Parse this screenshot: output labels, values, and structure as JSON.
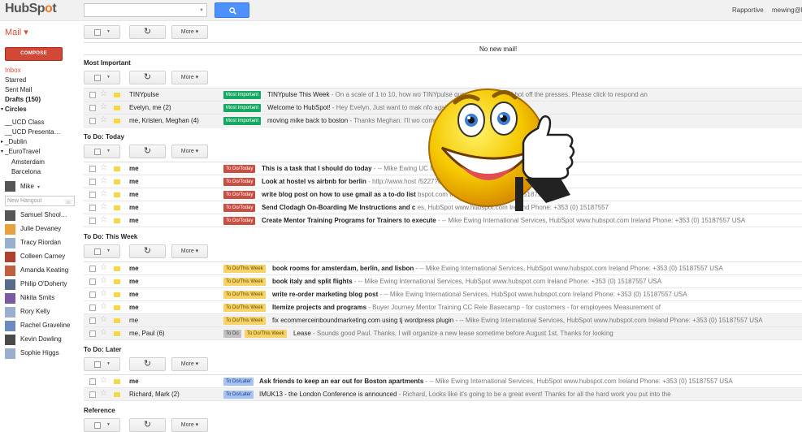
{
  "header": {
    "search_placeholder": "",
    "user_name": "Rapportive",
    "user_email": "mewing@l"
  },
  "sidebar": {
    "mail_label": "Mail ▾",
    "compose_label": "COMPOSE",
    "items": [
      {
        "label": "Inbox",
        "style": "red"
      },
      {
        "label": "Starred",
        "style": ""
      },
      {
        "label": "Sent Mail",
        "style": ""
      },
      {
        "label": "Drafts (150)",
        "style": "bold"
      },
      {
        "label": "Circles",
        "style": "bold"
      },
      {
        "label": "__UCD Class",
        "style": ""
      },
      {
        "label": "__UCD Presenta…",
        "style": ""
      },
      {
        "label": "_Dublin",
        "style": ""
      },
      {
        "label": "_EuroTravel",
        "style": ""
      },
      {
        "label": "Amsterdam",
        "style": ""
      },
      {
        "label": "Barcelona",
        "style": ""
      }
    ],
    "me_label": "Mike",
    "hangout_placeholder": "New Hangout",
    "contacts": [
      "Samuel Shool…",
      "Julie Devaney",
      "Tracy Riordan",
      "Colleen Carney",
      "Amanda Keating",
      "Philip O'Doherty",
      "Nikita Smits",
      "Rory Kelly",
      "Rachel Graveline",
      "Kevin Dowling",
      "Sophie Higgs"
    ]
  },
  "toolbar": {
    "more_label": "More ▾"
  },
  "top_panel": {
    "no_mail": "No new mail!"
  },
  "sections": [
    {
      "title": "Most Important",
      "rows": [
        {
          "sender": "TINYpulse",
          "labels": [
            {
              "text": "Most Important",
              "color": "green"
            }
          ],
          "subject": "TINYpulse This Week",
          "snippet": " - On a scale of 1 to 10, how wo                                        TINYpulse question is here and hot off the presses. Please click to respond an",
          "bold": false,
          "alt": true
        },
        {
          "sender": "Evelyn, me (2)",
          "labels": [
            {
              "text": "Most Important",
              "color": "green"
            }
          ],
          "subject": "Welcome to HubSpot!",
          "snippet": " - Hey Evelyn, Just want to mak                                        nfo again: 1.",
          "bold": false,
          "alt": true
        },
        {
          "sender": "me, Kristen, Meghan (4)",
          "labels": [
            {
              "text": "Most Important",
              "color": "green"
            }
          ],
          "subject": "moving mike back to boston",
          "snippet": " - Thanks Meghan. I'll wo                                                       company for either",
          "bold": false,
          "alt": true
        }
      ]
    },
    {
      "title": "To Do: Today",
      "rows": [
        {
          "sender": "me",
          "labels": [
            {
              "text": "To Do/Today",
              "color": "red"
            }
          ],
          "subject": "This is a task that I should do today",
          "snippet": " - -- Mike Ewing                                             UC Ireland Phone: +353 (0) 15187557 USA",
          "bold": true,
          "alt": false
        },
        {
          "sender": "me",
          "labels": [
            {
              "text": "To Do/Today",
              "color": "red"
            }
          ],
          "subject": "Look at hostel vs airbnb for berlin",
          "snippet": " - http://www.host                                               /5227?dateFrom=26+Jul+",
          "bold": true,
          "alt": false
        },
        {
          "sender": "me",
          "labels": [
            {
              "text": "To Do/Today",
              "color": "red"
            }
          ],
          "subject": "write blog post on how to use gmail as a to-do list",
          "snippet": "                                                  bspot.com Ireland Phone: +353 (0) 15187557 USA",
          "bold": true,
          "alt": false
        },
        {
          "sender": "me",
          "labels": [
            {
              "text": "To Do/Today",
              "color": "red"
            }
          ],
          "subject": "Send Clodagh On-Boarding Me Instructions and c",
          "snippet": "                                          es, HubSpot www.hubspot.com Ireland Phone: +353 (0) 15187557",
          "bold": true,
          "alt": false
        },
        {
          "sender": "me",
          "labels": [
            {
              "text": "To Do/Today",
              "color": "red"
            }
          ],
          "subject": "Create Mentor Training Programs for Trainers to execute",
          "snippet": " - -- Mike Ewing International Services, HubSpot www.hubspot.com Ireland Phone: +353 (0) 15187557 USA",
          "bold": true,
          "alt": false
        }
      ]
    },
    {
      "title": "To Do: This Week",
      "rows": [
        {
          "sender": "me",
          "labels": [
            {
              "text": "To Do/This Week",
              "color": "yellow"
            }
          ],
          "subject": "book rooms for amsterdam, berlin, and lisbon",
          "snippet": " - -- Mike Ewing International Services, HubSpot www.hubspot.com Ireland Phone: +353 (0) 15187557 USA",
          "bold": true,
          "alt": false
        },
        {
          "sender": "me",
          "labels": [
            {
              "text": "To Do/This Week",
              "color": "yellow"
            }
          ],
          "subject": "book italy and split flights",
          "snippet": " - -- Mike Ewing International Services, HubSpot www.hubspot.com Ireland Phone: +353 (0) 15187557 USA",
          "bold": true,
          "alt": false
        },
        {
          "sender": "me",
          "labels": [
            {
              "text": "To Do/This Week",
              "color": "yellow"
            }
          ],
          "subject": "write re-order marketing blog post",
          "snippet": " - -- Mike Ewing International Services, HubSpot www.hubspot.com Ireland Phone: +353 (0) 15187557 USA",
          "bold": true,
          "alt": false
        },
        {
          "sender": "me",
          "labels": [
            {
              "text": "To Do/This Week",
              "color": "yellow"
            }
          ],
          "subject": "Itemize projects and programs",
          "snippet": " - Buyer Journey Mentor Training CC Rele Basecamp - for customers - for employees Measurement of",
          "bold": true,
          "alt": false
        },
        {
          "sender": "me",
          "labels": [
            {
              "text": "To Do/This Week",
              "color": "yellow"
            }
          ],
          "subject": "fix ecommerceinboundmarketing.com using tj wordpress plugin",
          "snippet": " - -- Mike Ewing International Services, HubSpot www.hubspot.com Ireland Phone: +353 (0) 15187557 USA",
          "bold": false,
          "alt": true
        },
        {
          "sender": "me, Paul (6)",
          "labels": [
            {
              "text": "To Do",
              "color": "grey"
            },
            {
              "text": "To Do/This Week",
              "color": "yellow"
            }
          ],
          "subject": "Lease",
          "snippet": " - Sounds good Paul. Thanks. I will organize a new lease sometime before August 1st. Thanks for looking",
          "bold": false,
          "alt": true
        }
      ]
    },
    {
      "title": "To Do: Later",
      "rows": [
        {
          "sender": "me",
          "labels": [
            {
              "text": "To Do/Later",
              "color": "blue"
            }
          ],
          "subject": "Ask friends to keep an ear out for Boston apartments",
          "snippet": " - -- Mike Ewing International Services, HubSpot www.hubspot.com Ireland Phone: +353 (0) 15187557 USA",
          "bold": true,
          "alt": false
        },
        {
          "sender": "Richard, Mark (2)",
          "labels": [
            {
              "text": "To Do/Later",
              "color": "blue"
            }
          ],
          "subject": "IMUK13 - the London Conference is announced",
          "snippet": " - Richard, Looks like it's going to be a great event! Thanks for all the hard work you put into the",
          "bold": false,
          "alt": true
        }
      ]
    },
    {
      "title": "Reference",
      "rows": []
    }
  ]
}
